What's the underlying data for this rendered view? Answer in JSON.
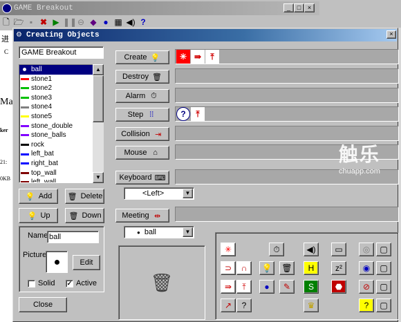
{
  "background_window": {
    "title": "GAME Breakout",
    "left_strip_text": [
      "进",
      "C",
      "Ma",
      "ker",
      "21:",
      "0KB"
    ]
  },
  "dialog": {
    "title": "Creating Objects",
    "close_label": "×",
    "game_name": "GAME Breakout",
    "objects": [
      {
        "name": "ball",
        "color": "#000000"
      },
      {
        "name": "stone1",
        "color": "#ff0000"
      },
      {
        "name": "stone2",
        "color": "#00c000"
      },
      {
        "name": "stone3",
        "color": "#00c000"
      },
      {
        "name": "stone4",
        "color": "#808080"
      },
      {
        "name": "stone5",
        "color": "#ffff00"
      },
      {
        "name": "stone_double",
        "color": "#8000ff"
      },
      {
        "name": "stone_balls",
        "color": "#8000ff"
      },
      {
        "name": "rock",
        "color": "#000000"
      },
      {
        "name": "left_bat",
        "color": "#0000ff"
      },
      {
        "name": "right_bat",
        "color": "#0000ff"
      },
      {
        "name": "top_wall",
        "color": "#800000"
      },
      {
        "name": "left_wall",
        "color": "#800000"
      }
    ],
    "selected_object": "ball",
    "buttons": {
      "add": "Add",
      "delete": "Delete",
      "up": "Up",
      "down": "Down",
      "edit": "Edit",
      "close": "Close"
    },
    "props": {
      "name_label": "Name",
      "name_value": "ball",
      "picture_label": "Picture",
      "solid_label": "Solid",
      "solid_checked": false,
      "active_label": "Active",
      "active_checked": true
    },
    "events": [
      {
        "label": "Create",
        "icon": "bulb-icon"
      },
      {
        "label": "Destroy",
        "icon": "trash-icon"
      },
      {
        "label": "Alarm",
        "icon": "clock-icon"
      },
      {
        "label": "Step",
        "icon": "footsteps-icon"
      },
      {
        "label": "Collision",
        "icon": "collision-icon"
      },
      {
        "label": "Mouse",
        "icon": "mouse-icon"
      },
      {
        "label": "Keyboard",
        "icon": "keyboard-icon"
      },
      {
        "label": "Meeting",
        "icon": "meeting-icon"
      }
    ],
    "keyboard_select": "<Left>",
    "meeting_select": "ball"
  },
  "watermark": {
    "main": "触乐",
    "sub": "chuapp.com"
  },
  "colors": {
    "title_start": "#0a246a",
    "title_end": "#a6caf0",
    "selection": "#000080",
    "bar": "#a8a8a8"
  }
}
